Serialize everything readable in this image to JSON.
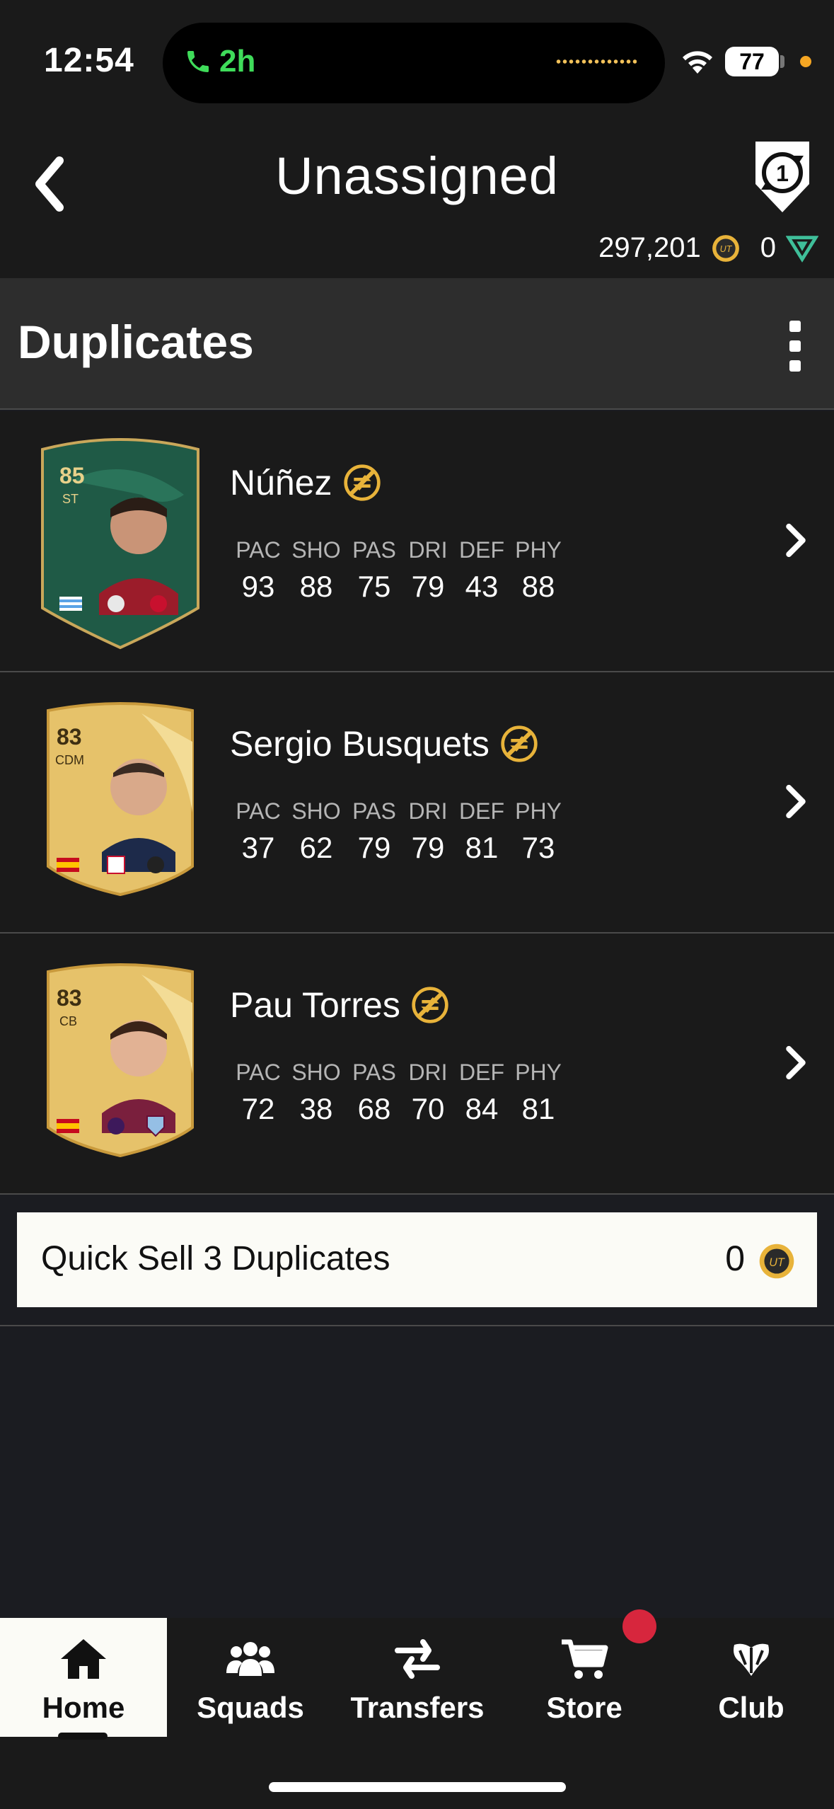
{
  "status_bar": {
    "time": "12:54",
    "call_duration": "2h",
    "battery": "77"
  },
  "header": {
    "title": "Unassigned",
    "coins": "297,201",
    "points": "0"
  },
  "section": {
    "title": "Duplicates"
  },
  "stat_labels": [
    "PAC",
    "SHO",
    "PAS",
    "DRI",
    "DEF",
    "PHY"
  ],
  "players": [
    {
      "name": "Núñez",
      "rating": "85",
      "position": "ST",
      "card_type": "special-green",
      "stats": [
        "93",
        "88",
        "75",
        "79",
        "43",
        "88"
      ]
    },
    {
      "name": "Sergio Busquets",
      "rating": "83",
      "position": "CDM",
      "card_type": "gold",
      "stats": [
        "37",
        "62",
        "79",
        "79",
        "81",
        "73"
      ]
    },
    {
      "name": "Pau Torres",
      "rating": "83",
      "position": "CB",
      "card_type": "gold",
      "stats": [
        "72",
        "38",
        "68",
        "70",
        "84",
        "81"
      ]
    }
  ],
  "quick_sell": {
    "label": "Quick Sell 3 Duplicates",
    "value": "0"
  },
  "tabs": [
    {
      "label": "Home",
      "icon": "home-icon",
      "active": true
    },
    {
      "label": "Squads",
      "icon": "squads-icon",
      "active": false
    },
    {
      "label": "Transfers",
      "icon": "transfers-icon",
      "active": false
    },
    {
      "label": "Store",
      "icon": "store-icon",
      "active": false,
      "badge": true
    },
    {
      "label": "Club",
      "icon": "club-icon",
      "active": false
    }
  ],
  "colors": {
    "background": "#1b1c21",
    "row": "#1a1a1a",
    "section_header": "#2d2d2d",
    "accent_gold": "#e8b33a",
    "call_green": "#3fdc5a",
    "badge_red": "#d7263d"
  }
}
